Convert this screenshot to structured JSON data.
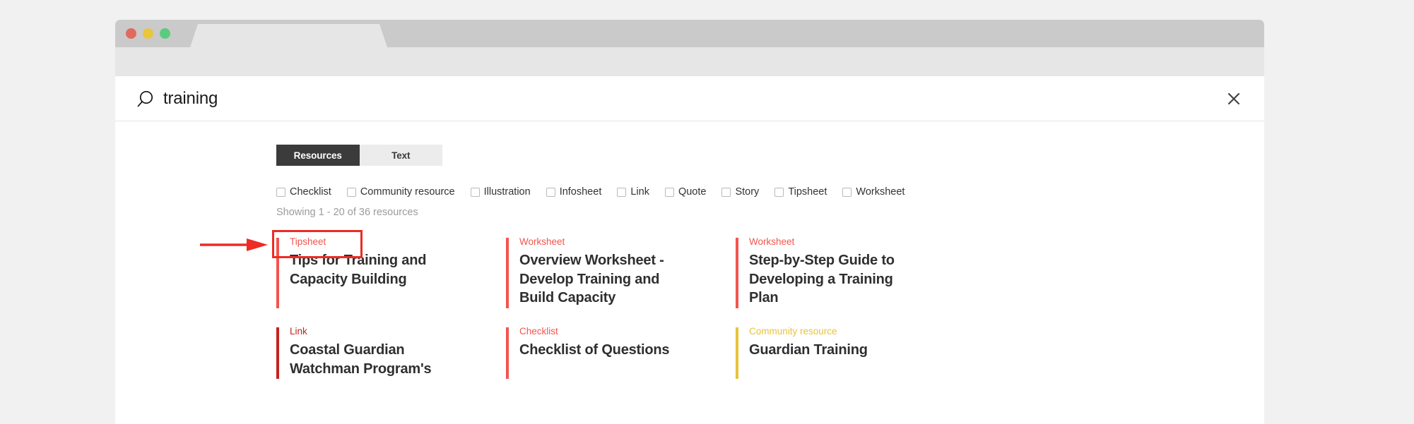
{
  "window": {
    "traffic_lights": [
      {
        "name": "close",
        "color": "#e06a5c"
      },
      {
        "name": "minimize",
        "color": "#e8c63e"
      },
      {
        "name": "maximize",
        "color": "#5ccb7f"
      }
    ],
    "tab_title": "",
    "titlebar_color": "#cacaca",
    "toolbar_color": "#e6e6e6"
  },
  "search": {
    "icon": "search-icon",
    "value": "training",
    "placeholder": "Search",
    "close_icon": "close-icon"
  },
  "tabs": [
    {
      "label": "Resources",
      "active": true
    },
    {
      "label": "Text",
      "active": false
    }
  ],
  "annotation": {
    "arrow_color": "#ee2b24",
    "box_color": "#ee2b24",
    "target": "Resources"
  },
  "filters": [
    {
      "label": "Checklist",
      "checked": false
    },
    {
      "label": "Community resource",
      "checked": false
    },
    {
      "label": "Illustration",
      "checked": false
    },
    {
      "label": "Infosheet",
      "checked": false
    },
    {
      "label": "Link",
      "checked": false
    },
    {
      "label": "Quote",
      "checked": false
    },
    {
      "label": "Story",
      "checked": false
    },
    {
      "label": "Tipsheet",
      "checked": false
    },
    {
      "label": "Worksheet",
      "checked": false
    }
  ],
  "results_count": "Showing 1 - 20 of 36 resources",
  "results": [
    {
      "category": "Tipsheet",
      "title": "Tips for Training and Capacity Building",
      "accent": "#f4544e"
    },
    {
      "category": "Worksheet",
      "title": "Overview Worksheet - Develop Training and Build Capacity",
      "accent": "#f4544e"
    },
    {
      "category": "Worksheet",
      "title": "Step-by-Step Guide to Developing a Training Plan",
      "accent": "#f4544e"
    },
    {
      "category": "Link",
      "title": "Coastal Guardian Watchman Program's",
      "accent": "#c4231e"
    },
    {
      "category": "Checklist",
      "title": "Checklist of Questions",
      "accent": "#f4544e"
    },
    {
      "category": "Community resource",
      "title": "Guardian Training",
      "accent": "#e8c33c"
    }
  ]
}
